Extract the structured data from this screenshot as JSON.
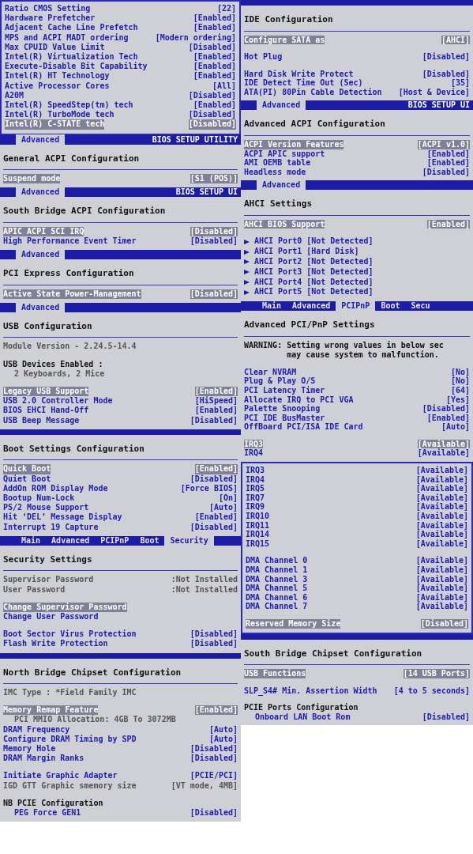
{
  "columns": [
    {
      "panels": [
        {
          "lines": [
            {
              "kind": "setting",
              "label": "Ratio CMOS Setting",
              "value": "[22]",
              "selected": false
            },
            {
              "kind": "setting",
              "label": "Hardware Prefetcher",
              "value": "[Enabled]",
              "selected": false
            },
            {
              "kind": "setting",
              "label": "Adjacent Cache Line Prefetch",
              "value": "[Enabled]",
              "selected": false
            },
            {
              "kind": "setting",
              "label": "MPS and ACPI MADT ordering",
              "value": "[Modern ordering]",
              "selected": false
            },
            {
              "kind": "setting",
              "label": "Max CPUID Value Limit",
              "value": "[Disabled]",
              "selected": false
            },
            {
              "kind": "setting",
              "label": "Intel(R) Virtualization Tech",
              "value": "[Enabled]",
              "selected": false
            },
            {
              "kind": "setting",
              "label": "Execute-Disable Bit Capability",
              "value": "[Enabled]",
              "selected": false
            },
            {
              "kind": "setting",
              "label": "Intel(R) HT Technology",
              "value": "[Enabled]",
              "selected": false
            },
            {
              "kind": "setting",
              "label": "Active Processor Cores",
              "value": "[All]",
              "selected": false
            },
            {
              "kind": "setting",
              "label": "A20M",
              "value": "[Disabled]",
              "selected": false
            },
            {
              "kind": "setting",
              "label": "Intel(R) SpeedStep(tm) tech",
              "value": "[Enabled]",
              "selected": false
            },
            {
              "kind": "setting",
              "label": "Intel(R) TurboMode tech",
              "value": "[Disabled]",
              "selected": false
            },
            {
              "kind": "setting",
              "label": "Intel(R) C-STATE tech",
              "value": "[Disabled]",
              "selected": true
            }
          ]
        },
        {
          "bar": {
            "utility": "BIOS SETUP UTILITY",
            "tabs": [
              {
                "label": "Advanced",
                "selected": true
              }
            ]
          },
          "title": "General ACPI Configuration",
          "lines": [
            {
              "kind": "setting",
              "label": "Suspend mode",
              "value": "[S1 (POS)]",
              "selected": true
            }
          ]
        },
        {
          "bar": {
            "utility": "BIOS SETUP UI",
            "tabs": [
              {
                "label": "Advanced",
                "selected": true
              }
            ]
          },
          "title": "South Bridge ACPI Configuration",
          "lines": [
            {
              "kind": "setting",
              "label": "APIC ACPI SCI IRQ",
              "value": "[Disabled]",
              "selected": true
            },
            {
              "kind": "setting",
              "label": "High Performance Event Timer",
              "value": "[Disabled]",
              "selected": false
            }
          ]
        },
        {
          "bar": {
            "tabs": [
              {
                "label": "Advanced",
                "selected": true
              }
            ]
          },
          "title": "PCI Express Configuration",
          "lines": [
            {
              "kind": "setting",
              "label": "Active State Power-Management",
              "value": "[Disabled]",
              "selected": true
            }
          ]
        },
        {
          "bar": {
            "tabs": [
              {
                "label": "Advanced",
                "selected": true
              }
            ]
          },
          "title": "USB Configuration",
          "lines": [
            {
              "kind": "info",
              "label": "Module Version - 2.24.5-14.4"
            },
            {
              "kind": "heading",
              "label": "USB Devices Enabled :",
              "gap_before": true,
              "children": [
                {
                  "kind": "info",
                  "label": "2 Keyboards, 2 Mice"
                }
              ]
            },
            {
              "kind": "setting",
              "label": "Legacy USB Support",
              "value": "[Enabled]",
              "selected": true,
              "gap_before": true
            },
            {
              "kind": "setting",
              "label": "USB 2.0 Controller Mode",
              "value": "[HiSpeed]",
              "selected": false
            },
            {
              "kind": "setting",
              "label": "BIOS EHCI Hand-Off",
              "value": "[Enabled]",
              "selected": false
            },
            {
              "kind": "setting",
              "label": "USB Beep Message",
              "value": "[Disabled]",
              "selected": false
            }
          ]
        },
        {
          "bar": {
            "kind": "plain"
          },
          "title": "Boot Settings Configuration",
          "lines": [
            {
              "kind": "setting",
              "label": "Quick Boot",
              "value": "[Enabled]",
              "selected": true
            },
            {
              "kind": "setting",
              "label": "Quiet Boot",
              "value": "[Disabled]",
              "selected": false
            },
            {
              "kind": "setting",
              "label": "AddOn ROM Display Mode",
              "value": "[Force BIOS]",
              "selected": false
            },
            {
              "kind": "setting",
              "label": "Bootup Num-Lock",
              "value": "[On]",
              "selected": false
            },
            {
              "kind": "setting",
              "label": "PS/2 Mouse Support",
              "value": "[Auto]",
              "selected": false
            },
            {
              "kind": "setting",
              "label": "Hit ‘DEL’ Message Display",
              "value": "[Enabled]",
              "selected": false
            },
            {
              "kind": "setting",
              "label": "Interrupt 19 Capture",
              "value": "[Disabled]",
              "selected": false
            }
          ]
        },
        {
          "bar": {
            "tabs": [
              {
                "label": "Main",
                "selected": false
              },
              {
                "label": "Advanced",
                "selected": false
              },
              {
                "label": "PCIPnP",
                "selected": false
              },
              {
                "label": "Boot",
                "selected": false
              },
              {
                "label": "Security",
                "selected": true
              }
            ]
          },
          "title": "Security Settings",
          "lines": [
            {
              "kind": "info",
              "label": "Supervisor Password",
              "value": ":Not Installed"
            },
            {
              "kind": "info",
              "label": "User Password",
              "value": ":Not Installed"
            },
            {
              "kind": "setting",
              "label": "Change Supervisor Password",
              "selected": true,
              "gap_before": true
            },
            {
              "kind": "setting",
              "label": "Change User Password",
              "selected": false
            },
            {
              "kind": "setting",
              "label": "Boot Sector Virus Protection",
              "value": "[Disabled]",
              "selected": false,
              "gap_before": true
            },
            {
              "kind": "setting",
              "label": "Flash Write Protection",
              "value": "[Disabled]",
              "selected": false
            }
          ]
        },
        {
          "bar": {
            "kind": "plain"
          },
          "title": "North Bridge Chipset Configuration",
          "lines": [
            {
              "kind": "info",
              "label": "IMC Type : *Field Family IMC"
            },
            {
              "kind": "setting",
              "label": "Memory Remap Feature",
              "value": "[Enabled]",
              "selected": true,
              "gap_before": true,
              "children": [
                {
                  "kind": "info",
                  "label": "PCI MMIO Allocation: 4GB To 3072MB"
                }
              ]
            },
            {
              "kind": "setting",
              "label": "DRAM Frequency",
              "value": "[Auto]",
              "selected": false
            },
            {
              "kind": "setting",
              "label": "Configure DRAM Timing by SPD",
              "value": "[Auto]",
              "selected": false
            },
            {
              "kind": "setting",
              "label": "Memory Hole",
              "value": "[Disabled]",
              "selected": false
            },
            {
              "kind": "setting",
              "label": "DRAM Margin Ranks",
              "value": "[Disabled]",
              "selected": false
            },
            {
              "kind": "setting",
              "label": "Initiate Graphic Adapter",
              "value": "[PCIE/PCI]",
              "selected": false,
              "gap_before": true
            },
            {
              "kind": "info",
              "label": "IGD GTT Graphic smemory size",
              "value": "[VT mode, 4MB]"
            },
            {
              "kind": "heading",
              "label": "NB PCIE Configuration",
              "gap_before": true,
              "children": [
                {
                  "kind": "setting",
                  "label": "PEG Force GEN1",
                  "value": "[Disabled]",
                  "selected": false
                }
              ]
            }
          ]
        }
      ]
    },
    {
      "panels": [
        {
          "bar": {
            "kind": "plain"
          },
          "title": "IDE Configuration",
          "lines": [
            {
              "kind": "setting",
              "label": "Configure SATA as",
              "value": "[AHCI]",
              "selected": true
            },
            {
              "kind": "setting",
              "label": "Hot Plug",
              "value": "[Disabled]",
              "selected": false,
              "gap_before": true
            },
            {
              "kind": "setting",
              "label": "Hard Disk Write Protect",
              "value": "[Disabled]",
              "selected": false,
              "gap_before": true
            },
            {
              "kind": "setting",
              "label": "IDE Detect Time Out (Sec)",
              "value": "[35]",
              "selected": false
            },
            {
              "kind": "setting",
              "label": "ATA(PI) 80Pin Cable Detection",
              "value": "[Host & Device]",
              "selected": false
            }
          ]
        },
        {
          "bar": {
            "utility": "BIOS SETUP UI",
            "tabs": [
              {
                "label": "Advanced",
                "selected": true
              }
            ]
          },
          "title": "Advanced ACPI Configuration",
          "lines": [
            {
              "kind": "setting",
              "label": "ACPI Version Features",
              "value": "[ACPI v1.0]",
              "selected": true
            },
            {
              "kind": "setting",
              "label": "ACPI APIC support",
              "value": "[Enabled]",
              "selected": false
            },
            {
              "kind": "setting",
              "label": "AMI OEMB table",
              "value": "[Enabled]",
              "selected": false
            },
            {
              "kind": "setting",
              "label": "Headless mode",
              "value": "[Disabled]",
              "selected": false
            }
          ]
        },
        {
          "bar": {
            "tabs": [
              {
                "label": "Advanced",
                "selected": true
              }
            ]
          },
          "title": "AHCI Settings",
          "lines": [
            {
              "kind": "setting",
              "label": "AHCI BIOS Support",
              "value": "[Enabled]",
              "selected": true
            },
            {
              "kind": "submenu",
              "label": "AHCI Port0",
              "value": "[Not Detected]",
              "gap_before": true
            },
            {
              "kind": "submenu",
              "label": "AHCI Port1",
              "value": "[Hard Disk]"
            },
            {
              "kind": "submenu",
              "label": "AHCI Port2",
              "value": "[Not Detected]"
            },
            {
              "kind": "submenu",
              "label": "AHCI Port3",
              "value": "[Not Detected]"
            },
            {
              "kind": "submenu",
              "label": "AHCI Port4",
              "value": "[Not Detected]"
            },
            {
              "kind": "submenu",
              "label": "AHCI Port5",
              "value": "[Not Detected]"
            }
          ]
        },
        {
          "bar": {
            "tabs": [
              {
                "label": "Main",
                "selected": false
              },
              {
                "label": "Advanced",
                "selected": false
              },
              {
                "label": "PCIPnP",
                "selected": true
              },
              {
                "label": "Boot",
                "selected": false
              },
              {
                "label": "Secu",
                "selected": false
              }
            ]
          },
          "title": "Advanced PCI/PnP Settings",
          "lines": [
            {
              "kind": "warning",
              "label": "WARNING:",
              "text_lines": [
                "Setting wrong values in below sec",
                "may cause system to malfunction."
              ]
            },
            {
              "kind": "setting",
              "label": "Clear NVRAM",
              "value": "[No]",
              "selected": false,
              "gap_before": true
            },
            {
              "kind": "setting",
              "label": "Plug & Play O/S",
              "value": "[No]",
              "selected": false
            },
            {
              "kind": "setting",
              "label": "PCI Latency Timer",
              "value": "[64]",
              "selected": false
            },
            {
              "kind": "setting",
              "label": "Allocate IRQ to PCI VGA",
              "value": "[Yes]",
              "selected": false
            },
            {
              "kind": "setting",
              "label": "Palette Snooping",
              "value": "[Disabled]",
              "selected": false
            },
            {
              "kind": "setting",
              "label": "PCI IDE BusMaster",
              "value": "[Enabled]",
              "selected": false
            },
            {
              "kind": "setting",
              "label": "OffBoard PCI/ISA IDE Card",
              "value": "[Auto]",
              "selected": false
            },
            {
              "kind": "setting",
              "label": "IRQ3",
              "value": "[Available]",
              "selected": true,
              "gap_before": true
            },
            {
              "kind": "setting",
              "label": "IRQ4",
              "value": "[Available]",
              "selected": false
            }
          ]
        },
        {
          "lines": [
            {
              "kind": "setting",
              "label": "IRQ3",
              "value": "[Available]",
              "selected": false
            },
            {
              "kind": "setting",
              "label": "IRQ4",
              "value": "[Available]",
              "selected": false
            },
            {
              "kind": "setting",
              "label": "IRQ5",
              "value": "[Available]",
              "selected": false
            },
            {
              "kind": "setting",
              "label": "IRQ7",
              "value": "[Available]",
              "selected": false
            },
            {
              "kind": "setting",
              "label": "IRQ9",
              "value": "[Available]",
              "selected": false
            },
            {
              "kind": "setting",
              "label": "IRQ10",
              "value": "[Available]",
              "selected": false
            },
            {
              "kind": "setting",
              "label": "IRQ11",
              "value": "[Available]",
              "selected": false
            },
            {
              "kind": "setting",
              "label": "IRQ14",
              "value": "[Available]",
              "selected": false
            },
            {
              "kind": "setting",
              "label": "IRQ15",
              "value": "[Available]",
              "selected": false
            },
            {
              "kind": "setting",
              "label": "DMA Channel 0",
              "value": "[Available]",
              "selected": false,
              "gap_before": true
            },
            {
              "kind": "setting",
              "label": "DMA Channel 1",
              "value": "[Available]",
              "selected": false
            },
            {
              "kind": "setting",
              "label": "DMA Channel 3",
              "value": "[Available]",
              "selected": false
            },
            {
              "kind": "setting",
              "label": "DMA Channel 5",
              "value": "[Available]",
              "selected": false
            },
            {
              "kind": "setting",
              "label": "DMA Channel 6",
              "value": "[Available]",
              "selected": false
            },
            {
              "kind": "setting",
              "label": "DMA Channel 7",
              "value": "[Available]",
              "selected": false
            },
            {
              "kind": "setting",
              "label": "Reserved Memory Size",
              "value": "[Disabled]",
              "selected": true,
              "gap_before": true
            }
          ]
        },
        {
          "bar": {
            "kind": "plain"
          },
          "title": "South Bridge Chipset Configuration",
          "lines": [
            {
              "kind": "setting",
              "label": "USB Functions",
              "value": "[14 USB Ports]",
              "selected": true
            },
            {
              "kind": "setting",
              "label": "SLP_S4# Min. Assertion Width",
              "value": "[4 to 5 seconds]",
              "selected": false,
              "gap_before": true
            },
            {
              "kind": "heading",
              "label": "PCIE Ports Configuration",
              "gap_before": true,
              "children": [
                {
                  "kind": "setting",
                  "label": "Onboard LAN Boot Rom",
                  "value": "[Disabled]",
                  "selected": false
                }
              ]
            }
          ]
        }
      ]
    }
  ]
}
